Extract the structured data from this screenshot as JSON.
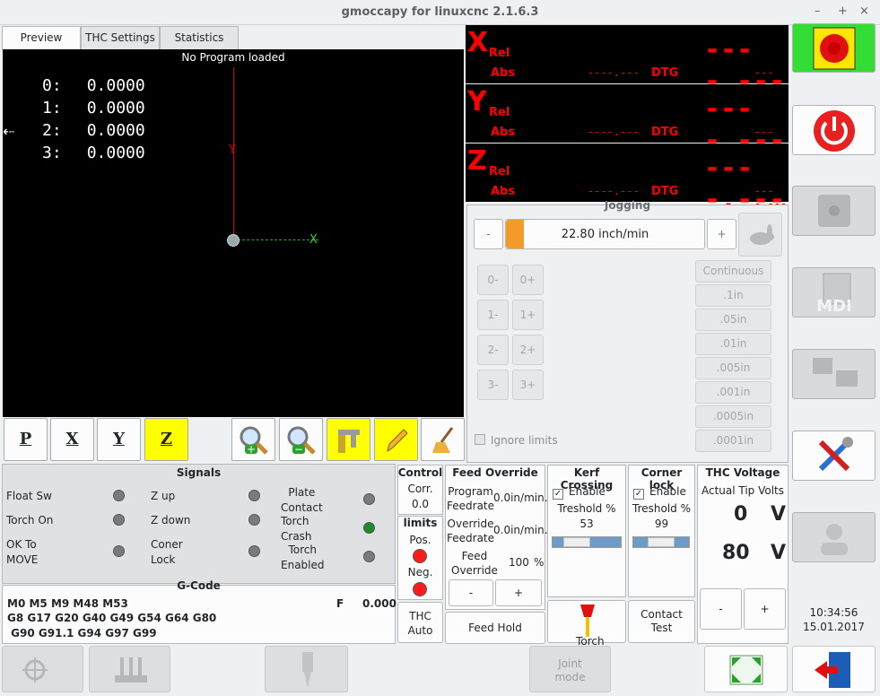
{
  "window": {
    "title": "gmoccapy for linuxcnc  2.1.6.3",
    "controls": [
      "–",
      "+",
      "×"
    ]
  },
  "tabs": [
    {
      "label": "Preview"
    },
    {
      "label": "THC Settings"
    },
    {
      "label": "Statistics"
    }
  ],
  "preview": {
    "status": "No Program loaded",
    "offsets": [
      {
        "label": "0:",
        "value": "0.0000"
      },
      {
        "label": "1:",
        "value": "0.0000"
      },
      {
        "label": "2:",
        "value": "0.0000"
      },
      {
        "label": "3:",
        "value": "0.0000"
      }
    ],
    "axis_x": "X",
    "axis_y": "Y"
  },
  "view_toolbar": {
    "p": "P",
    "x": "X",
    "y": "Y",
    "z": "Z"
  },
  "axes": [
    {
      "letter": "X",
      "rel_label": "Rel",
      "abs_label": "Abs",
      "abs_value": "----.---",
      "dtg_label": "DTG",
      "dtg_value": "----.---",
      "rel_value": "----.---"
    },
    {
      "letter": "Y",
      "rel_label": "Rel",
      "abs_label": "Abs",
      "abs_value": "----.---",
      "dtg_label": "DTG",
      "dtg_value": "----.---",
      "rel_value": "----.---"
    },
    {
      "letter": "Z",
      "rel_label": "Rel",
      "abs_label": "Abs",
      "abs_value": "----.---",
      "dtg_label": "DTG",
      "dtg_value": "----.---",
      "rel_value": "----.---"
    }
  ],
  "jogging": {
    "title": "Jogging",
    "minus": "-",
    "plus": "+",
    "speed": "22.80 inch/min",
    "speed_fraction": 0.05,
    "jog_buttons": [
      "0-",
      "0+",
      "1-",
      "1+",
      "2-",
      "2+",
      "3-",
      "3+"
    ],
    "increments": [
      "Continuous",
      ".1in",
      ".05in",
      ".01in",
      ".005in",
      ".001in",
      ".0005in",
      ".0001in"
    ],
    "ignore_limits": "Ignore limits"
  },
  "signals": {
    "title": "Signals",
    "items": [
      {
        "label": "Float Sw",
        "state": "off"
      },
      {
        "label": "Torch On",
        "state": "off"
      },
      {
        "label": "OK To\nMOVE",
        "state": "off"
      },
      {
        "label": "Z up",
        "state": "off"
      },
      {
        "label": "Z down",
        "state": "off"
      },
      {
        "label": "Coner\nLock",
        "state": "off"
      },
      {
        "label": "Plate\nContact",
        "state": "off"
      },
      {
        "label": "Torch\nCrash",
        "state": "on"
      },
      {
        "label": "Torch\nEnabled",
        "state": "off"
      }
    ]
  },
  "gcode": {
    "title": "G-Code",
    "lines": [
      "M0 M5 M9 M48 M53",
      "G8 G17 G20 G40 G49 G54 G64 G80",
      " G90 G91.1 G94 G97 G99"
    ],
    "f_label": "F",
    "f_value": "0.000"
  },
  "control": {
    "title": "Control",
    "corr_label": "Corr.",
    "corr_value": "0.0",
    "limits_title": "limits",
    "pos": "Pos.",
    "neg": "Neg.",
    "thc_auto": "THC\nAuto"
  },
  "feed_override": {
    "title": "Feed Override",
    "program_label": "Program\nFeedrate",
    "program_value": "0.0in/min.",
    "override_label": "Override\nFeedrate",
    "override_value": "0.0in/min.",
    "feed_override_label": "Feed\nOverride",
    "feed_override_value": "100",
    "unit": "%",
    "minus": "-",
    "plus": "+",
    "feed_hold": "Feed Hold"
  },
  "kerf": {
    "title": "Kerf Crossing",
    "enable": "Enable",
    "threshold_label": "Treshold %",
    "threshold_value": "53",
    "slider_fraction": 0.53
  },
  "corner": {
    "title": "Corner lock",
    "enable": "Enable",
    "threshold_label": "Treshold %",
    "threshold_value": "99",
    "slider_fraction": 0.99
  },
  "thc_voltage": {
    "title": "THC Voltage",
    "actual_label": "Actual Tip Volts",
    "actual_value": "0",
    "actual_unit": "V",
    "target_value": "80",
    "target_unit": "V",
    "minus": "-",
    "plus": "+"
  },
  "torch_enable": "Torch\nEnable",
  "contact_test": "Contact\nTest",
  "clock": {
    "time": "10:34:56",
    "date": "15.01.2017"
  },
  "bottom": {
    "joint_mode": "Joint\nmode"
  },
  "colors": {
    "accent_red": "#ff0000",
    "estop_bg": "#33dd33",
    "yellow": "#ffff00",
    "led_on": "#1e8c2a"
  }
}
